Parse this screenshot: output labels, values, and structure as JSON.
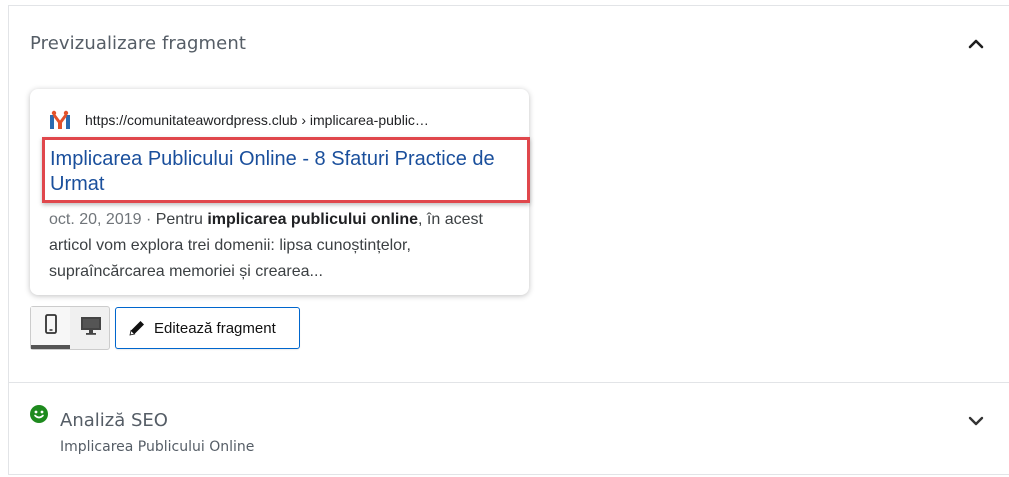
{
  "snippet_section": {
    "title": "Previzualizare fragment"
  },
  "snippet": {
    "url": "https://comunitateawordpress.club › implicarea-public…",
    "title": "Implicarea Publicului Online - 8 Sfaturi Practice de Urmat",
    "date": "oct. 20, 2019",
    "separator": " · ",
    "desc_before": "Pentru ",
    "desc_bold": "implicarea publicului online",
    "desc_after": ", în acest articol vom explora trei domenii: lipsa cunoștințelor, supraîncărcarea memoriei și crearea..."
  },
  "controls": {
    "mobile_icon": "mobile-icon",
    "desktop_icon": "desktop-icon",
    "edit_label": "Editează fragment",
    "edit_icon": "pencil-icon"
  },
  "seo_section": {
    "title": "Analiză SEO",
    "subtitle": "Implicarea Publicului Online",
    "status_icon": "smiley-icon",
    "status_color": "#1e8a1e"
  },
  "colors": {
    "link": "#1a4f9c",
    "highlight": "#e0474c",
    "edit_border": "#0066cd"
  }
}
